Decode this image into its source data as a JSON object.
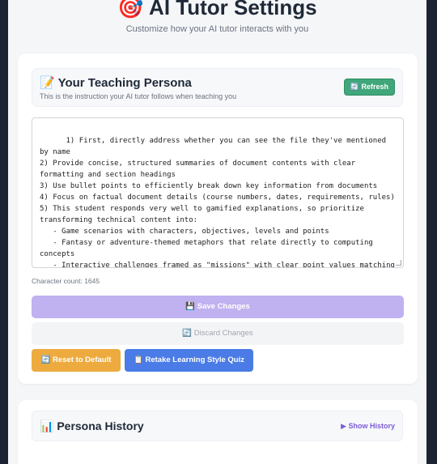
{
  "header": {
    "title": "🎯 AI Tutor Settings",
    "subtitle": "Customize how your AI tutor interacts with you"
  },
  "persona": {
    "title": "📝 Your Teaching Persona",
    "subtitle": "This is the instruction your AI tutor follows when teaching you",
    "refresh_label": "🔄 Refresh",
    "text": "1) First, directly address whether you can see the file they've mentioned by name\n2) Provide concise, structured summaries of document contents with clear formatting and section headings\n3) Use bullet points to efficiently break down key information from documents\n4) Focus on factual document details (course numbers, dates, requirements, rules)\n5) This student responds very well to gamified explanations, so prioritize transforming technical content into:\n   - Game scenarios with characters, objectives, levels and points\n   - Fantasy or adventure-themed metaphors that relate directly to computing concepts\n   - Interactive challenges framed as \"missions\" with clear point values matching the original document\n   - Emoji to enhance visual engagement",
    "char_count": "Character count: 1645"
  },
  "actions": {
    "save_label": "💾 Save Changes",
    "discard_label": "🔄 Discard Changes",
    "reset_label": "🔄 Reset to Default",
    "quiz_label": "📋 Retake Learning Style Quiz"
  },
  "history": {
    "title": "📊 Persona History",
    "toggle_label": "▶ Show History"
  },
  "colors": {
    "refresh": "#3fa77a",
    "save": "#c0b1f0",
    "reset": "#edab3f",
    "quiz": "#4a7be6",
    "history_link": "#7c5cd6"
  }
}
